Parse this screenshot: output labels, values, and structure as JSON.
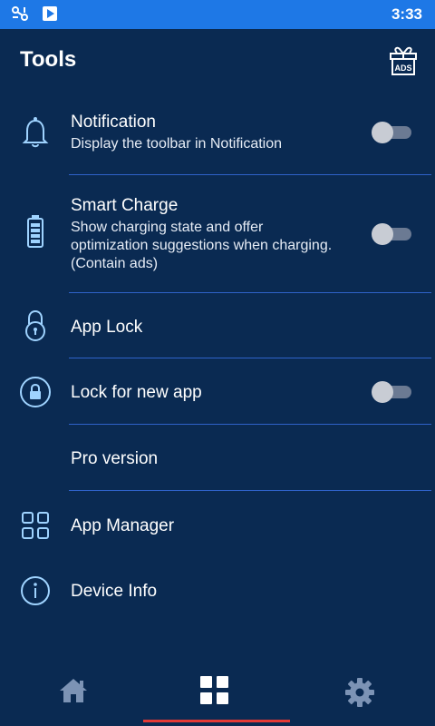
{
  "status_bar": {
    "time": "3:33",
    "icons": [
      "tether-icon",
      "play-store-icon"
    ]
  },
  "header": {
    "title": "Tools",
    "ads_badge": "ADS"
  },
  "items": [
    {
      "id": "notification",
      "label": "Notification",
      "desc": "Display the toolbar in Notification",
      "icon": "bell-icon",
      "toggle": false
    },
    {
      "id": "smart-charge",
      "label": "Smart Charge",
      "desc": "Show charging state and offer optimization suggestions when charging. (Contain ads)",
      "icon": "battery-icon",
      "toggle": false
    },
    {
      "id": "app-lock",
      "label": "App Lock",
      "desc": "",
      "icon": "padlock-icon"
    },
    {
      "id": "lock-new-app",
      "label": "Lock for new app",
      "desc": "",
      "icon": "circle-lock-icon",
      "toggle": false
    },
    {
      "id": "pro-version",
      "label": "Pro version",
      "desc": ""
    },
    {
      "id": "app-manager",
      "label": "App Manager",
      "desc": "",
      "icon": "grid-icon"
    },
    {
      "id": "device-info",
      "label": "Device Info",
      "desc": "",
      "icon": "info-icon"
    }
  ],
  "bottom_nav": {
    "tabs": [
      "home-icon",
      "tools-grid-icon",
      "settings-gear-icon"
    ],
    "active": "tools-grid-icon"
  },
  "colors": {
    "background": "#0a2a52",
    "status_bar": "#1e78e6",
    "icon_accent": "#9fd3ff",
    "divider": "#2f62c9",
    "active_indicator": "#e53935"
  }
}
